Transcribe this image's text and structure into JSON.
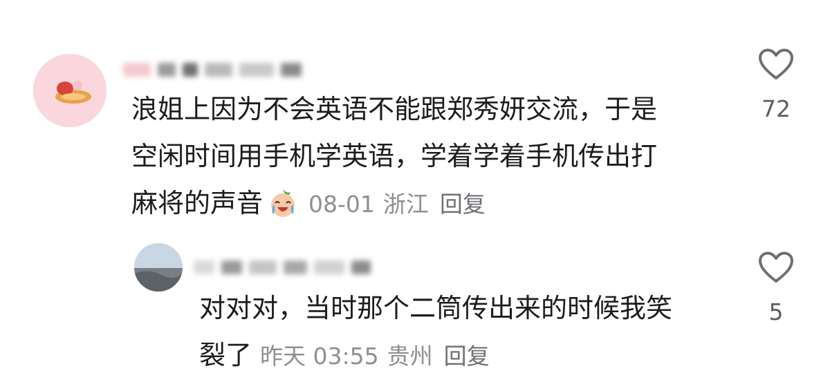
{
  "comments": [
    {
      "text_lines": [
        "浪姐上因为不会英语不能跟郑秀妍交流，于是",
        "空闲时间用手机学英语，学着学着手机传出打",
        "麻将的声音"
      ],
      "emoji": "crying-laughing-emoji",
      "date": "08-01",
      "location": "浙江",
      "reply_label": "回复",
      "likes": "72"
    },
    {
      "text_lines": [
        "对对对，当时那个二筒传出来的时候我笑",
        "裂了"
      ],
      "date": "昨天 03:55",
      "location": "贵州",
      "reply_label": "回复",
      "likes": "5"
    }
  ],
  "colors": {
    "text": "#1c1c1c",
    "meta": "#8e8e93",
    "icon": "#6e6e73"
  }
}
